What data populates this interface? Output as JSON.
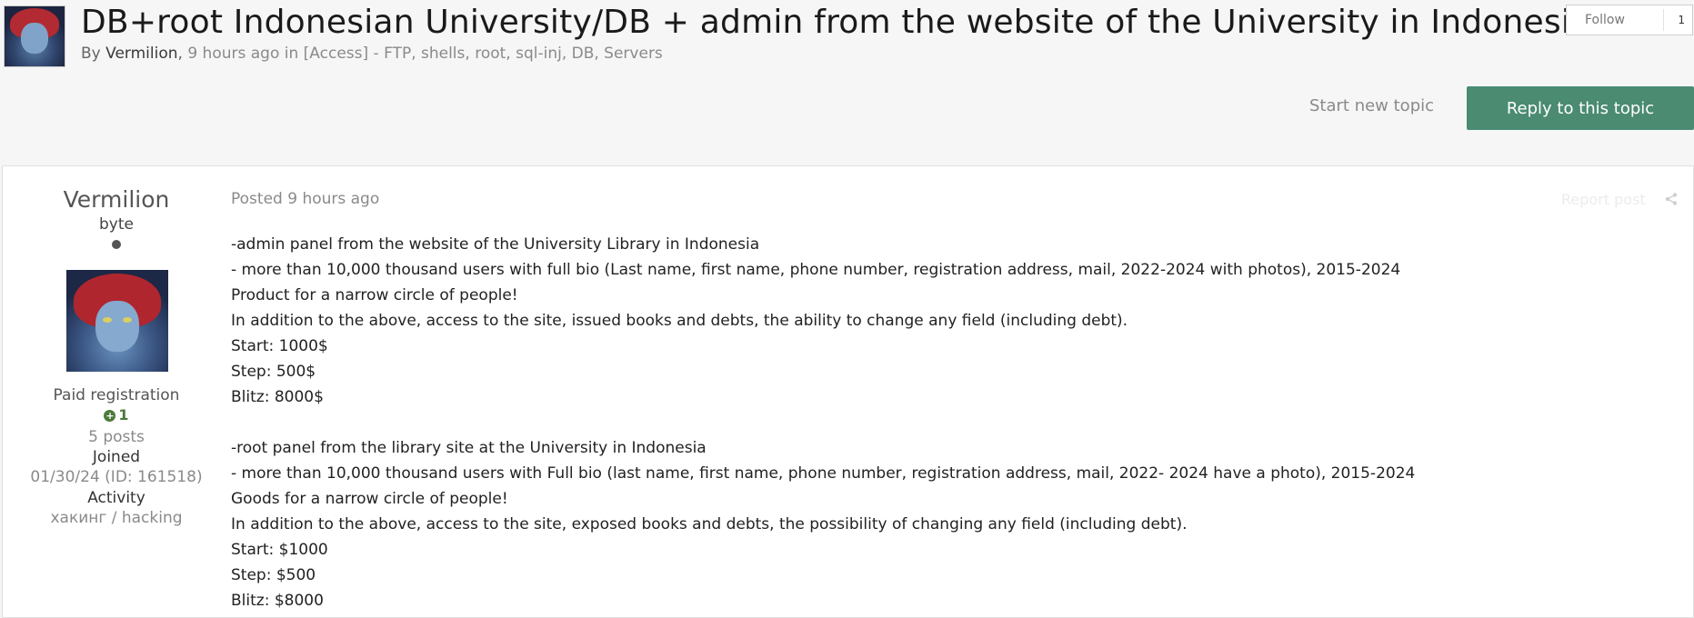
{
  "topic": {
    "title": "DB+root Indonesian University/DB + admin from the website of the University in Indonesia",
    "by_label": "By",
    "author": "Vermilion",
    "time": "9 hours ago",
    "in_label": "in",
    "category": "[Access] - FTP, shells, root, sql-inj, DB, Servers",
    "follow_label": "Follow",
    "follow_count": "1"
  },
  "actions": {
    "start_new_topic": "Start new topic",
    "reply": "Reply to this topic"
  },
  "post": {
    "author": {
      "name": "Vermilion",
      "rank": "byte",
      "group": "Paid registration",
      "reputation": "1",
      "posts": "5 posts",
      "joined_label": "Joined",
      "joined_value": "01/30/24 (ID: 161518)",
      "activity_label": "Activity",
      "activity_value": "хакинг / hacking"
    },
    "posted": "Posted 9 hours ago",
    "report": "Report post",
    "lines": [
      "-admin panel from the website of the University Library in Indonesia",
      "- more than 10,000 thousand users with full bio (Last name, first name, phone number, registration address, mail, 2022-2024 with photos), 2015-2024",
      "Product for a narrow circle of people!",
      "In addition to the above, access to the site, issued books and debts, the ability to change any field (including debt).",
      "Start: 1000$",
      "Step: 500$",
      "Blitz: 8000$",
      "",
      "-root panel from the library site at the University in Indonesia",
      "- more than 10,000 thousand users with Full bio (last name, first name, phone number, registration address, mail, 2022- 2024 have a photo), 2015-2024",
      "Goods for a narrow circle of people!",
      "In addition to the above, access to the site, exposed books and debts, the possibility of changing any field (including debt).",
      "Start: $1000",
      "Step: $500",
      "Blitz: $8000"
    ]
  },
  "colors": {
    "accent": "#4a8b72",
    "background": "#f6f6f6",
    "muted_text": "#8a8a8a"
  }
}
